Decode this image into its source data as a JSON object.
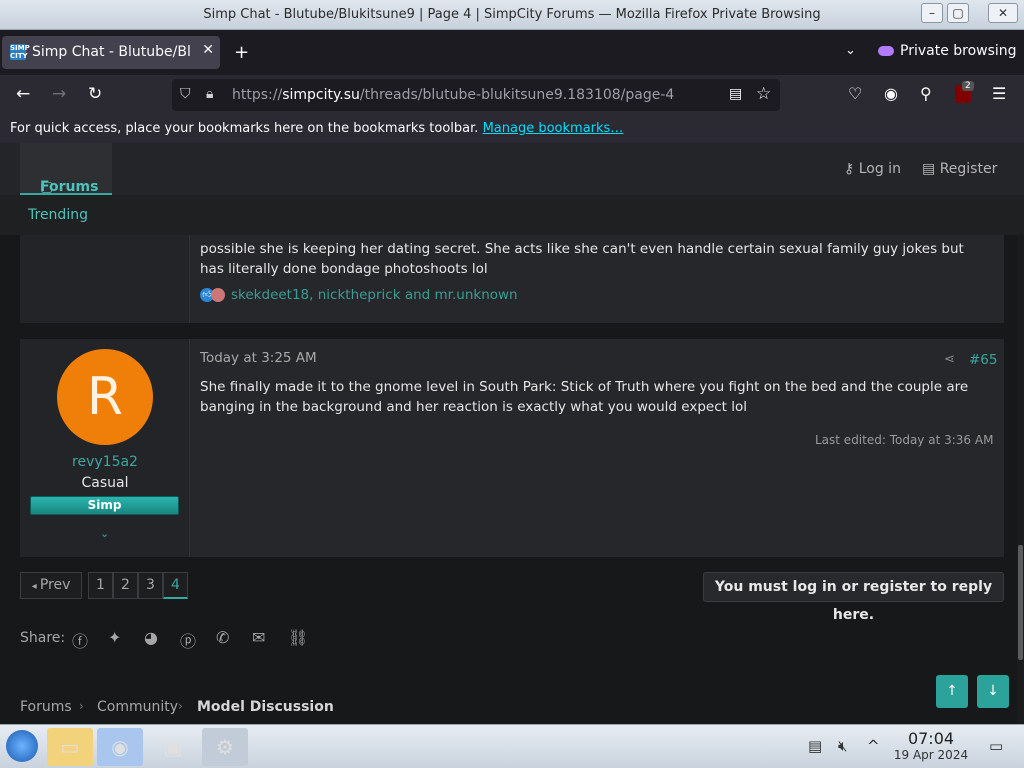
{
  "window": {
    "title": "Simp Chat - Blutube/Blukitsune9 | Page 4 | SimpCity Forums — Mozilla Firefox Private Browsing"
  },
  "tab": {
    "title": "Simp Chat - Blutube/Bluk",
    "favicon": "SIMP CITY"
  },
  "browser": {
    "private_label": "Private browsing",
    "url_prefix": "https://",
    "url_domain": "simpcity.su",
    "url_path": "/threads/blutube-blukitsune9.183108/page-4",
    "ublock_count": "2",
    "bookmarks_text": "For quick access, place your bookmarks here on the bookmarks toolbar.",
    "bookmarks_link": "Manage bookmarks…"
  },
  "site": {
    "forums_label": "Forums",
    "login_label": "Log in",
    "register_label": "Register",
    "subnav_trending": "Trending"
  },
  "post1": {
    "text": "possible she is keeping her dating secret. She acts like she can't even handle certain sexual family guy jokes but has literally done bondage photoshoots lol",
    "reactions": "skekdeet18, nicktheprick and mr.unknown"
  },
  "post2": {
    "avatar_letter": "R",
    "username": "revy15a2",
    "user_title": "Casual",
    "banner": "Simp",
    "date": "Today at 3:25 AM",
    "number": "#65",
    "text": "She finally made it to the gnome level in South Park: Stick of Truth where you fight on the bed and the couple are banging in the background and her reaction is exactly what you would expect lol",
    "edited": "Last edited: Today at 3:36 AM"
  },
  "pagination": {
    "prev": "Prev",
    "pages": [
      "1",
      "2",
      "3",
      "4"
    ],
    "current": "4"
  },
  "reply_notice": "You must log in or register to reply here.",
  "share_label": "Share:",
  "breadcrumbs": [
    "Forums",
    "Community",
    "Model Discussion"
  ],
  "taskbar": {
    "time": "07:04",
    "date": "19 Apr 2024"
  },
  "colors": {
    "accent": "#3aa6a0",
    "avatar": "#f07f0a",
    "page_bg": "#17181a"
  }
}
